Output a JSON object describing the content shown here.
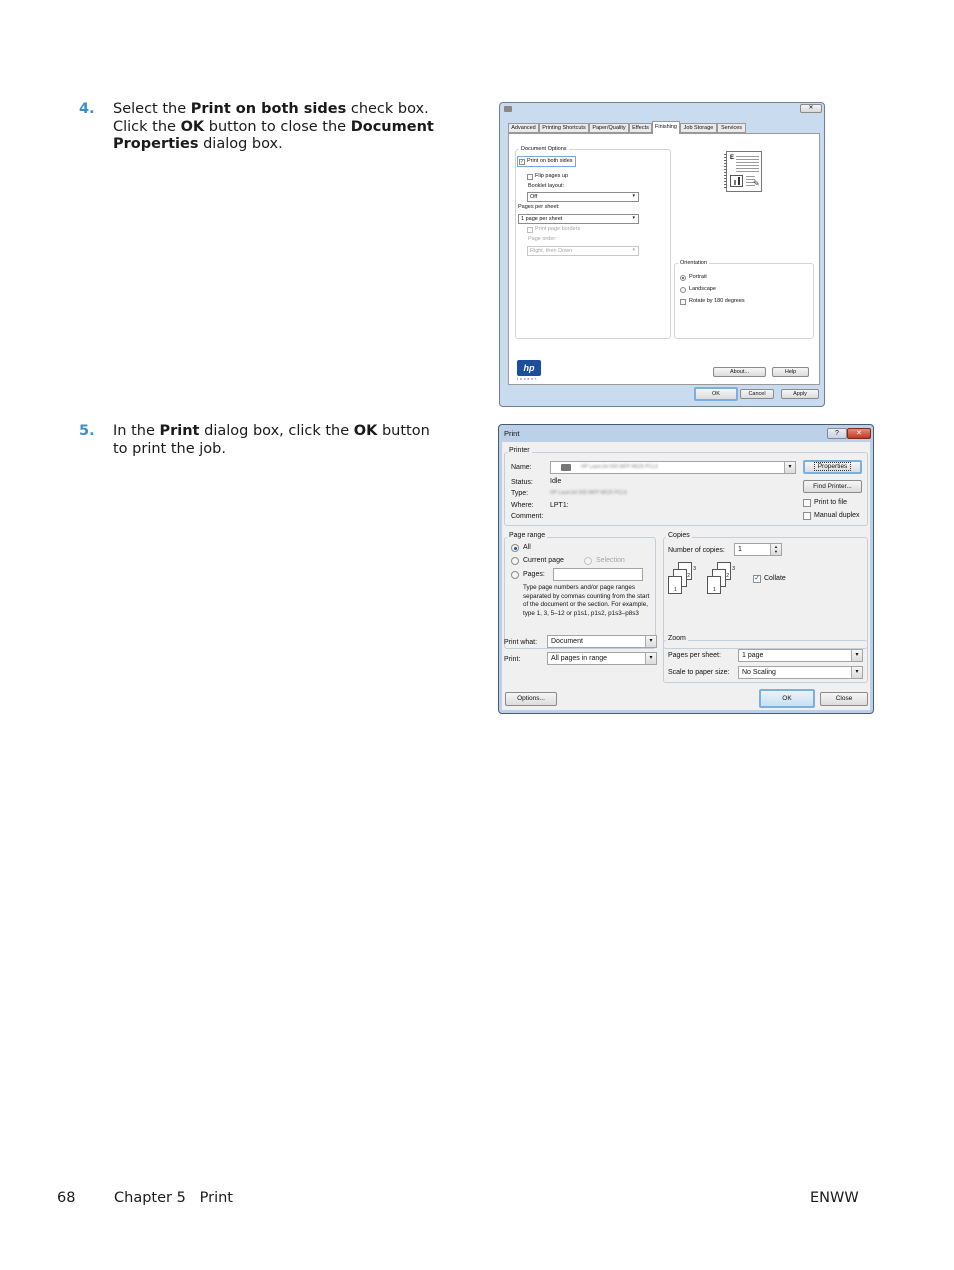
{
  "steps": [
    {
      "number": "4.",
      "segments": [
        {
          "text": "Select the ",
          "bold": false
        },
        {
          "text": "Print on both sides",
          "bold": true
        },
        {
          "text": " check box. Click the ",
          "bold": false
        },
        {
          "text": "OK",
          "bold": true
        },
        {
          "text": " button to close the ",
          "bold": false
        },
        {
          "text": "Document Properties",
          "bold": true
        },
        {
          "text": " dialog box.",
          "bold": false
        }
      ]
    },
    {
      "number": "5.",
      "segments": [
        {
          "text": "In the ",
          "bold": false
        },
        {
          "text": "Print",
          "bold": true
        },
        {
          "text": " dialog box, click the ",
          "bold": false
        },
        {
          "text": "OK",
          "bold": true
        },
        {
          "text": " button to print the job.",
          "bold": false
        }
      ]
    }
  ],
  "doc_properties_dialog": {
    "close_glyph": "✕",
    "tabs": [
      "Advanced",
      "Printing Shortcuts",
      "Paper/Quality",
      "Effects",
      "Finishing",
      "Job Storage",
      "Services"
    ],
    "active_tab": "Finishing",
    "document_options_title": "Document Options",
    "print_both_sides": {
      "label": "Print on both sides",
      "checked": true
    },
    "flip_pages_up": {
      "label": "Flip pages up",
      "checked": false
    },
    "booklet_layout_label": "Booklet layout:",
    "booklet_layout_value": "Off",
    "pages_per_sheet_label": "Pages per sheet:",
    "pages_per_sheet_value": "1 page per sheet",
    "print_page_borders": {
      "label": "Print page borders",
      "checked": false
    },
    "page_order_label": "Page order:",
    "page_order_value": "Right, then Down",
    "orientation_title": "Orientation",
    "orientation_options": [
      {
        "label": "Portrait",
        "selected": true
      },
      {
        "label": "Landscape",
        "selected": false
      }
    ],
    "rotate_180": {
      "label": "Rotate by 180 degrees",
      "checked": false
    },
    "logo_text": "hp",
    "logo_sub": "invent",
    "about_label": "About...",
    "help_label": "Help",
    "ok_label": "OK",
    "cancel_label": "Cancel",
    "apply_label": "Apply"
  },
  "print_dialog": {
    "title": "Print",
    "help_glyph": "?",
    "close_glyph": "✕",
    "printer_group": "Printer",
    "name_label": "Name:",
    "name_value": "HP LaserJet 500 MFP M525 PCL6",
    "status_label": "Status:",
    "status_value": "Idle",
    "type_label": "Type:",
    "type_value": "HP LaserJet 500 MFP M525 PCL6",
    "where_label": "Where:",
    "where_value": "LPT1:",
    "comment_label": "Comment:",
    "comment_value": "",
    "properties_label": "Properties",
    "find_printer_label": "Find Printer...",
    "print_to_file": {
      "label": "Print to file",
      "checked": false
    },
    "manual_duplex": {
      "label": "Manual duplex",
      "checked": false
    },
    "page_range_group": "Page range",
    "range_all": {
      "label": "All",
      "selected": true
    },
    "range_current": {
      "label": "Current page",
      "selected": false
    },
    "range_selection": {
      "label": "Selection",
      "selected": false
    },
    "range_pages": {
      "label": "Pages:",
      "selected": false
    },
    "pages_value": "",
    "range_hint": "Type page numbers and/or page ranges separated by commas counting from the start of the document or the section. For example, type 1, 3, 5–12 or p1s1, p1s2, p1s3–p8s3",
    "copies_group": "Copies",
    "copies_label": "Number of copies:",
    "copies_value": "1",
    "collate": {
      "label": "Collate",
      "checked": true
    },
    "collate_pages": [
      "1",
      "2",
      "3"
    ],
    "print_what_label": "Print what:",
    "print_what_value": "Document",
    "print_label": "Print:",
    "print_value": "All pages in range",
    "zoom_group": "Zoom",
    "pages_per_sheet_label": "Pages per sheet:",
    "pages_per_sheet_value": "1 page",
    "scale_label": "Scale to paper size:",
    "scale_value": "No Scaling",
    "options_label": "Options...",
    "ok_label": "OK",
    "close_label": "Close"
  },
  "footer": {
    "page_number": "68",
    "chapter": "Chapter 5   Print",
    "right": "ENWW"
  }
}
